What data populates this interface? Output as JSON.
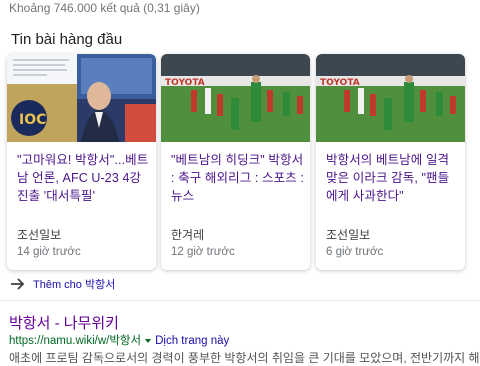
{
  "search": {
    "result_stats": "Khoảng 746.000 kết quả (0,31 giây)"
  },
  "top_stories": {
    "title": "Tin bài hàng đầu",
    "cards": [
      {
        "headline": "\"고마워요! 박항서\"...베트남 언론, AFC U-23 4강 진출 '대서특필'",
        "source": "조선일보",
        "time": "14 giờ trước",
        "thumb_text": "IOC"
      },
      {
        "headline": "\"베트남의 히딩크\" 박항서 : 축구 해외리그 : 스포츠 : 뉴스",
        "source": "한겨레",
        "time": "12 giờ trước",
        "thumb_text": "TOYOTA"
      },
      {
        "headline": "박항서의 베트남에 일격 맞은 이라크 감독, \"팬들에게 사과한다\"",
        "source": "조선일보",
        "time": "6 giờ trước",
        "thumb_text": "TOYOTA"
      }
    ],
    "more_label": "Thêm cho 박항서"
  },
  "result": {
    "title": "박항서 - 나무위키",
    "url": "https://namu.wiki/w/박항서",
    "translate_label": "Dịch trang này",
    "snippet": "애초에 프로팀 감독으로서의 경력이 풍부한 박항서의 취임을 큰 기대를 모았으며, 전반기까지 해도 잘해 지원시"
  },
  "colors": {
    "visited_link": "#4a148c",
    "link": "#1a0dab",
    "url_green": "#006621",
    "muted": "#70757a",
    "jersey_red": "#c0392b",
    "jersey_green": "#2e8b3a",
    "pitch": "#4f8f3d"
  },
  "icons": {
    "more": "arrow-right-icon",
    "caret": "caret-down-icon"
  }
}
